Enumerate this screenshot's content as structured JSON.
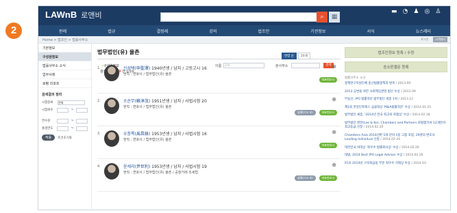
{
  "badge": "2",
  "header": {
    "brand_small": "",
    "logo": "LAWnB",
    "logo_kr": "로앤비",
    "icons": [
      {
        "name": "folder-icon",
        "glyph": "▬",
        "label": ""
      },
      {
        "name": "clock-icon",
        "glyph": "◔",
        "label": ""
      },
      {
        "name": "bell-icon",
        "glyph": "♟",
        "label": ""
      },
      {
        "name": "headset-icon",
        "glyph": "◎",
        "label": ""
      },
      {
        "name": "user-icon",
        "glyph": "♙",
        "label": ""
      }
    ]
  },
  "nav": [
    "판례",
    "법규",
    "결정례",
    "강의",
    "법조인",
    "기관정보",
    "서식",
    "뉴스레터"
  ],
  "crumb": "Home > 법조인 > 법률사무소",
  "crumb_buttons": [
    "로그인",
    "고객센터"
  ],
  "sidebar": {
    "items": [
      "기본정보",
      "구성원정보",
      "법률사무소 소식",
      "업무사례",
      "로펌 리포트"
    ],
    "active_index": 1,
    "filter_title": "검색결과 정리",
    "filter_rows": [
      {
        "label": "시험종류",
        "value": "전체"
      },
      {
        "label": "시험회수",
        "value": ""
      },
      {
        "label": "연수원",
        "value": ""
      },
      {
        "label": "출생연도",
        "value": ""
      }
    ],
    "apply": "적용",
    "reset": "조건초기화"
  },
  "main": {
    "title": "법무법인(유) 율촌",
    "sub_heading": "구성원정보",
    "count_prefix": "검색결과 ",
    "count_value": "199",
    "count_suffix": " 건 1/10",
    "search_label_1": "이름",
    "search_placeholder": "검색",
    "search_label_2": "분사무소",
    "search_button": "검색",
    "sort": [
      "연령 순",
      "20개"
    ]
  },
  "members": [
    {
      "num": "1.",
      "name": "신성택(申聖澤)",
      "info": " 1940년생 / 남자 / 고등고시 16",
      "position": "현직 : 변호사 / 법무법인(유) 율촌",
      "tags": [
        "대표변호사"
      ]
    },
    {
      "num": "2.",
      "name": "소순무(蘇淳茂)",
      "info": " 1951년생 / 남자 / 사법시험 20",
      "position": "현직 : 변호사 / 법무법인(유) 율촌",
      "tags": [
        "法律(기고 외)",
        "대표변호사"
      ]
    },
    {
      "num": "3.",
      "name": "우창록(禹昌錄)",
      "info": " 1953년생 / 남자 / 사법시험 16",
      "position": "현직 : 변호사 / 법무법인(유) 율촌",
      "tags": [
        "대표변호사"
      ]
    },
    {
      "num": "4.",
      "name": "윤세리(尹世利)",
      "info": " 1953년생 / 남자 / 사법시험 19",
      "position": "현직 : 변호사 / 법무법인(유) 율촌 / 공정거래 조세법",
      "tags": [
        "法律(기고 외)",
        "대표변호사"
      ]
    }
  ],
  "right": {
    "btn1": "법조인정보 등록 / 수정",
    "btn2": "승소판결문 등록",
    "news_head": "법률사무소 소식",
    "news": [
      {
        "t": "정책연구지원단체 중선법률정책과 발족",
        "d": " / 2013.09"
      },
      {
        "t": "2013 공변을 위한 사회책임경영 법인 수상",
        "d": " / 2013.09"
      },
      {
        "t": "부동산, IPO 법률자문 법무법인 세종 1위",
        "d": " / 2013.12"
      },
      {
        "t": "제1회 한양인포에스 금융대상 'M&A법률자문' 수상",
        "d": " / 2014.01.21"
      },
      {
        "t": "법무법인 세종, '2014년 한국 최고의 로펌상' 수상",
        "d": " / 2014.02.18"
      },
      {
        "t": "법무법인 영한(Lee & Ko), Chambers and Partners 로펌평가서 12개분야 최고등급 선정",
        "d": " / 2014.02.20"
      },
      {
        "t": "Chambers Asia 2014년판 5개 분야 1등 그룹 포함, 29명의 변호사 Leading Individual 선정",
        "d": " / 2014.02.24"
      },
      {
        "t": "대한민국 비대상 '최우수 법률회사상' 수상",
        "d": " / 2014.02.26"
      },
      {
        "t": "대법, 2014 Best IPO Legal Advisor 수상",
        "d": " / 2014.02.26"
      },
      {
        "t": "IFLR 2014년 구조화금융 부문 최우수 거래상 수상",
        "d": " / 2014.03"
      }
    ]
  }
}
